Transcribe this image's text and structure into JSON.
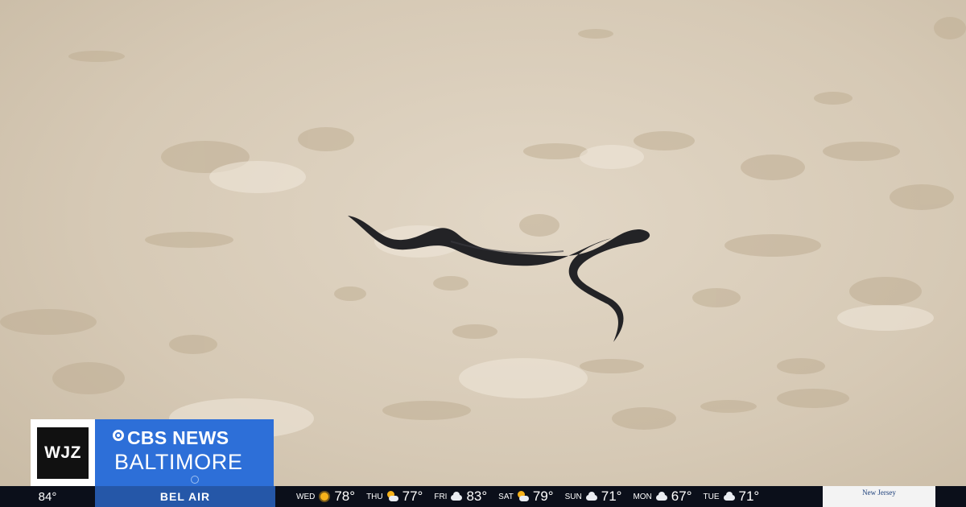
{
  "scene": {
    "subject": "snake-on-sand"
  },
  "station_bug": {
    "station_logo": "WJZ",
    "network": "CBS NEWS",
    "city": "BALTIMORE"
  },
  "ticker": {
    "current_temp": "84°",
    "location": "BEL AIR",
    "forecast": [
      {
        "day": "WED",
        "icon": "sun-icon",
        "temp": "78°"
      },
      {
        "day": "THU",
        "icon": "sun-cloud-icon",
        "temp": "77°"
      },
      {
        "day": "FRI",
        "icon": "cloud-icon",
        "temp": "83°"
      },
      {
        "day": "SAT",
        "icon": "sun-cloud-icon",
        "temp": "79°"
      },
      {
        "day": "SUN",
        "icon": "cloud-icon",
        "temp": "71°"
      },
      {
        "day": "MON",
        "icon": "cloud-icon",
        "temp": "67°"
      },
      {
        "day": "TUE",
        "icon": "cloud-icon",
        "temp": "71°"
      }
    ],
    "sponsor": "New Jersey"
  },
  "colors": {
    "network_blue": "#2d6fd8",
    "location_blue": "#2557a8",
    "ticker_bg": "#0b0f1a",
    "snake": "#232326",
    "sand": "#d8ccba"
  }
}
